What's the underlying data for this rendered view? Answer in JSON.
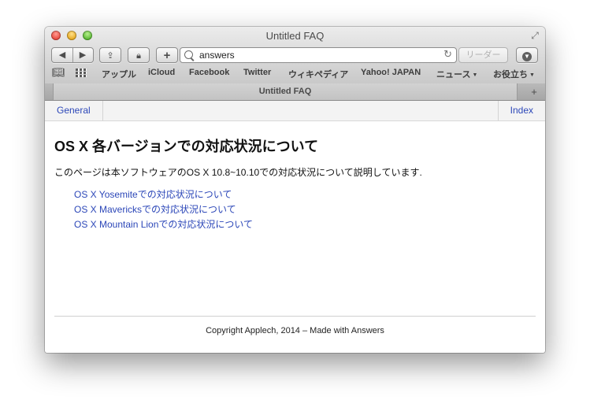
{
  "window": {
    "title": "Untitled FAQ"
  },
  "toolbar": {
    "back_icon": "back-arrow-icon",
    "forward_icon": "forward-arrow-icon",
    "address_value": "answers",
    "reader_label": "リーダー"
  },
  "bookmarks": [
    "アップル",
    "iCloud",
    "Facebook",
    "Twitter",
    "ウィキペディア",
    "Yahoo! JAPAN",
    "ニュース",
    "お役立ち"
  ],
  "tab": {
    "label": "Untitled FAQ"
  },
  "subnav": {
    "general": "General",
    "index": "Index"
  },
  "content": {
    "heading": "OS X 各バージョンでの対応状況について",
    "description": "このページは本ソフトウェアのOS X 10.8~10.10での対応状況について説明しています.",
    "links": [
      "OS X Yosemiteでの対応状況について",
      "OS X Mavericksでの対応状況について",
      "OS X Mountain Lionでの対応状況について"
    ],
    "footer": "Copyright Applech, 2014 – Made with Answers"
  },
  "colors": {
    "link": "#2c47b8",
    "close": "#e8453a",
    "minimize": "#e6a81e",
    "zoom": "#54b52e"
  }
}
